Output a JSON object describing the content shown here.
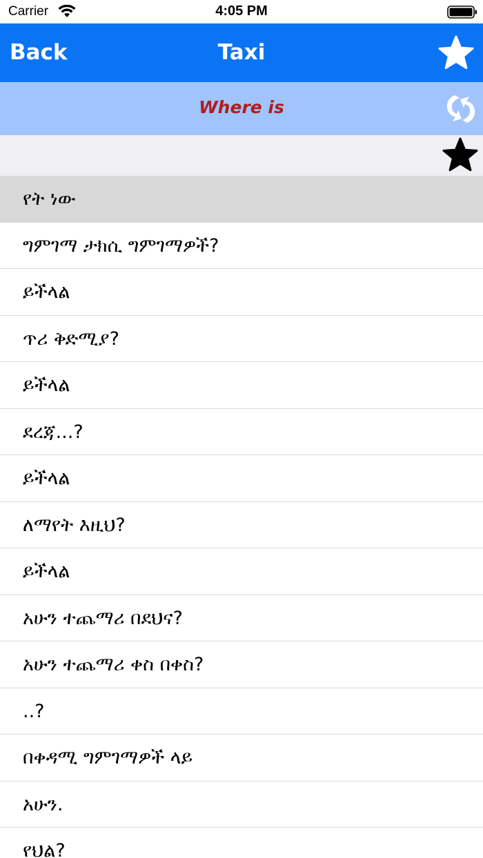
{
  "status_bar": {
    "carrier": "Carrier",
    "time": "4:05 PM",
    "wifi_icon": "wifi-icon",
    "battery_icon": "battery-icon"
  },
  "nav": {
    "back_label": "Back",
    "title": "Taxi",
    "favorite_icon": "star-outline-icon",
    "bg_color": "#0a74f5"
  },
  "sub_header": {
    "label": "Where is",
    "label_color": "#b01e1e",
    "bg_color": "#a2c4fd",
    "swap_icon": "swap-language-icon"
  },
  "fav_strip": {
    "favorite_icon": "star-filled-icon"
  },
  "list": {
    "header": "የት ነው",
    "items": [
      "ግምገማ ታክሲ ግምገማዎች?",
      "ይችላል",
      "ጥሪ ቅድሚያ?",
      "ይችላል",
      "ደረጃ...?",
      "ይችላል",
      "ለማየት እዚህ?",
      "ይችላል",
      "አሁን ተጨማሪ በደህና?",
      "አሁን ተጨማሪ ቀስ በቀስ?",
      "..?",
      "በቀዳሚ ግምገማዎች ላይ",
      "አሁን.",
      "የህል?"
    ]
  }
}
